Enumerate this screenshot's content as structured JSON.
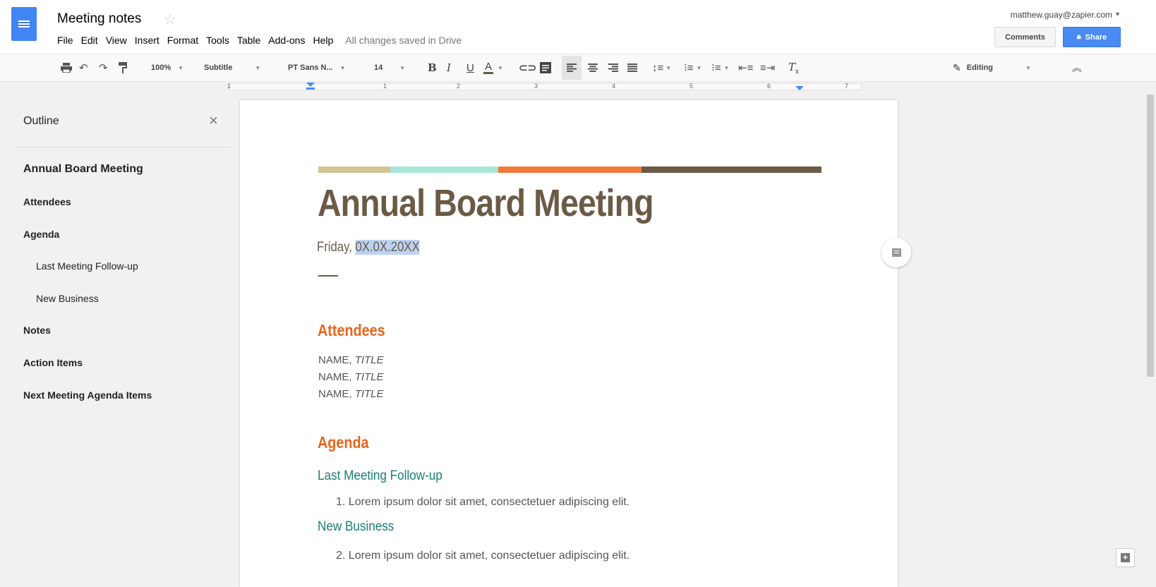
{
  "app": {
    "title": "Meeting notes",
    "status": "All changes saved in Drive",
    "user_email": "matthew.guay@zapier.com"
  },
  "menu": [
    "File",
    "Edit",
    "View",
    "Insert",
    "Format",
    "Tools",
    "Table",
    "Add-ons",
    "Help"
  ],
  "header_buttons": {
    "comments": "Comments",
    "share": "Share"
  },
  "toolbar": {
    "zoom": "100%",
    "style": "Subtitle",
    "font": "PT Sans N...",
    "size": "14",
    "bold": "B",
    "italic": "I",
    "underline": "U",
    "text_color": "A",
    "mode": "Editing"
  },
  "ruler": [
    "1",
    "1",
    "2",
    "3",
    "4",
    "5",
    "6",
    "7"
  ],
  "outline": {
    "title": "Outline",
    "items": [
      {
        "label": "Annual Board Meeting"
      },
      {
        "label": "Attendees"
      },
      {
        "label": "Agenda"
      },
      {
        "label": "Last Meeting Follow-up"
      },
      {
        "label": "New Business"
      },
      {
        "label": "Notes"
      },
      {
        "label": "Action Items"
      },
      {
        "label": "Next Meeting Agenda Items"
      }
    ]
  },
  "document": {
    "stripe_colors": [
      "#d2c393",
      "#a8e6d8",
      "#ef7a3c",
      "#6b5b46"
    ],
    "heading": "Annual Board Meeting",
    "date_prefix": "Friday, ",
    "date_value": "0X.0X.20XX",
    "attendees_heading": "Attendees",
    "attendees": [
      {
        "name": "NAME, ",
        "title": "TITLE"
      },
      {
        "name": "NAME, ",
        "title": "TITLE"
      },
      {
        "name": "NAME, ",
        "title": "TITLE"
      }
    ],
    "agenda_heading": "Agenda",
    "sub1_heading": "Last Meeting Follow-up",
    "item1": "1.  Lorem ipsum dolor sit amet, consectetuer adipiscing elit.",
    "sub2_heading": "New Business",
    "item2": "2.  Lorem ipsum dolor sit amet, consectetuer adipiscing elit."
  },
  "colors": {
    "accent_blue": "#4a8af4",
    "heading_brown": "#6b5b46",
    "heading_orange": "#e8641b",
    "heading_teal": "#1a7f74"
  }
}
